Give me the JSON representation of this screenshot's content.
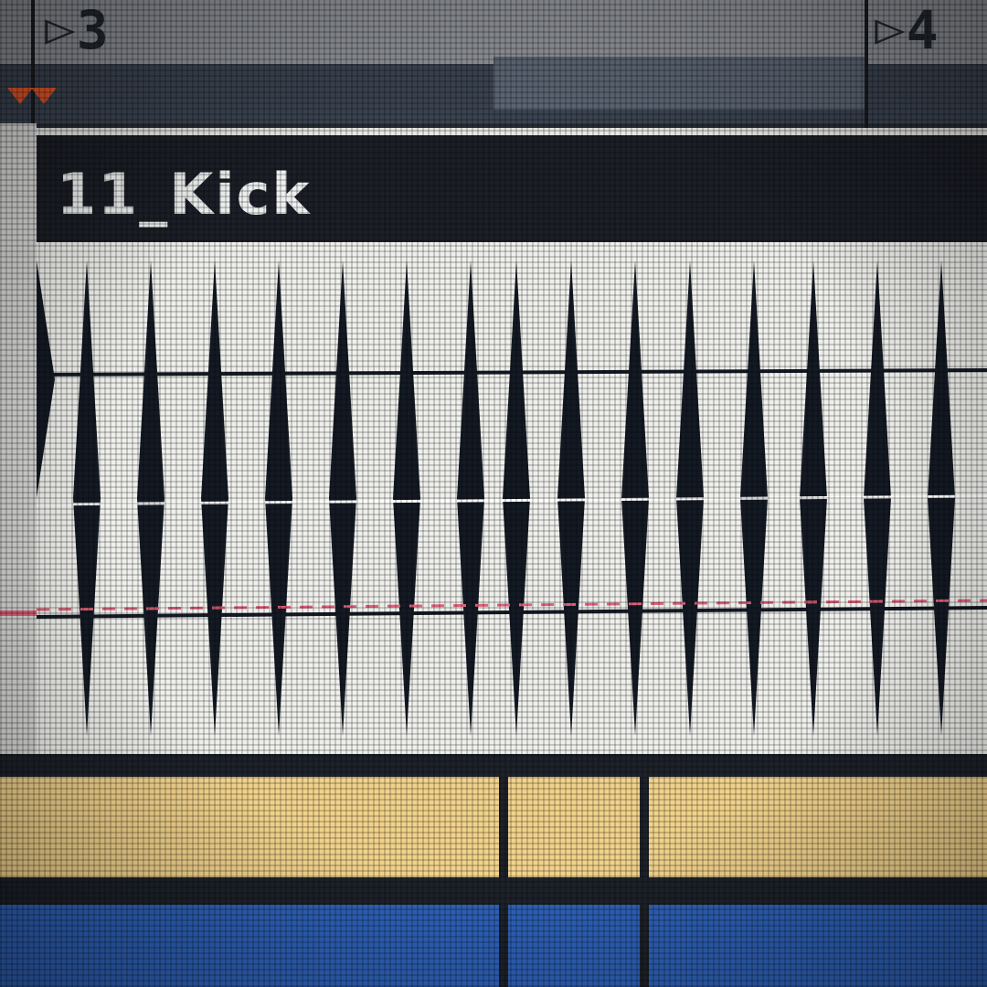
{
  "ruler": {
    "markers": [
      "3",
      "4"
    ]
  },
  "clip": {
    "name": "11_Kick"
  },
  "colors": {
    "clip_header": "#1c1f27",
    "waveform_background": "#efefec",
    "waveform": "#141a24",
    "cursor_line": "#e0607a",
    "yellow_lane": "#f1d28b",
    "blue_lane": "#2e61b8",
    "loop_marker": "#e0552a"
  },
  "icons": {
    "bar_marker": "play-triangle-icon",
    "loop_marker": "loop-start-triangle-icon"
  }
}
